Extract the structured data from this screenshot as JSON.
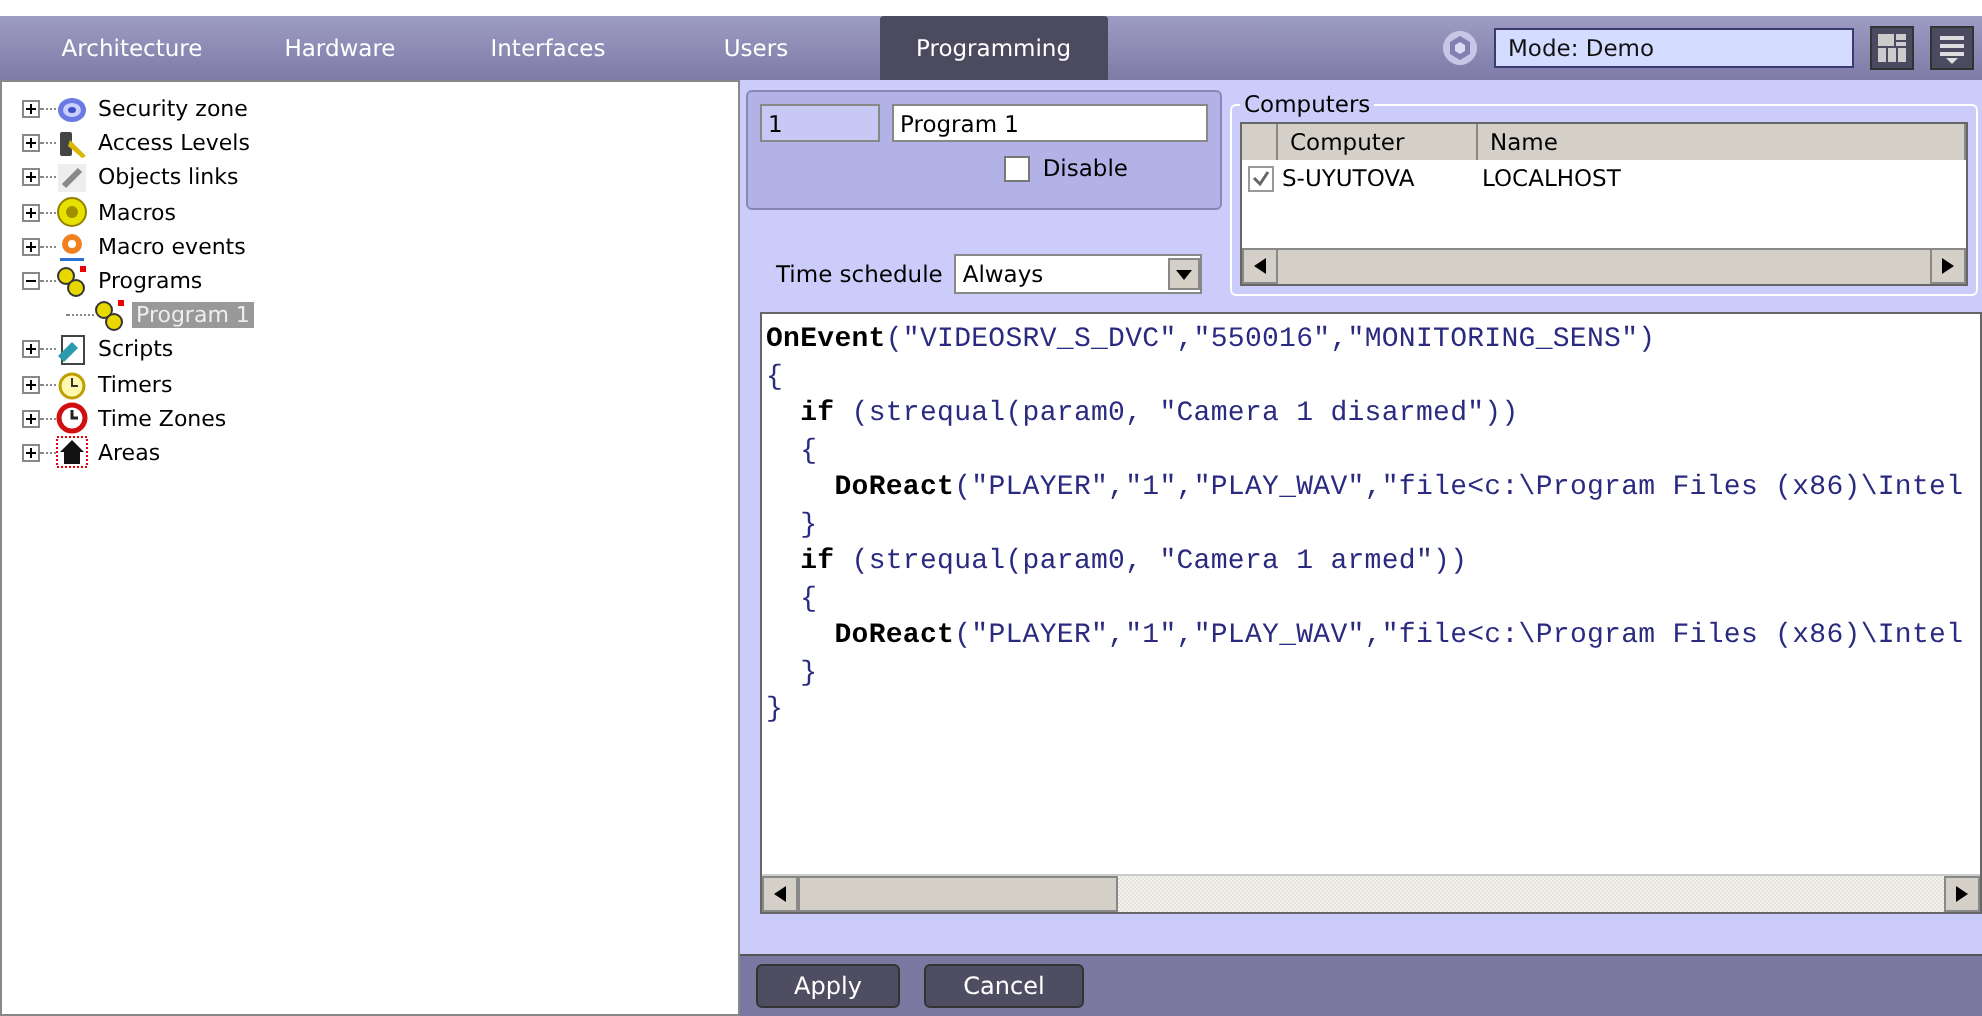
{
  "tabs": [
    {
      "label": "Architecture",
      "selected": false
    },
    {
      "label": "Hardware",
      "selected": false
    },
    {
      "label": "Interfaces",
      "selected": false
    },
    {
      "label": "Users",
      "selected": false
    },
    {
      "label": "Programming",
      "selected": true
    }
  ],
  "mode": {
    "value": "Mode: Demo"
  },
  "tree": [
    {
      "label": "Security zone",
      "kind": "zone",
      "expanded": false,
      "selected": false
    },
    {
      "label": "Access Levels",
      "kind": "key",
      "expanded": false,
      "selected": false
    },
    {
      "label": "Objects links",
      "kind": "link",
      "expanded": false,
      "selected": false
    },
    {
      "label": "Macros",
      "kind": "macro",
      "expanded": false,
      "selected": false
    },
    {
      "label": "Macro events",
      "kind": "event",
      "expanded": false,
      "selected": false
    },
    {
      "label": "Programs",
      "kind": "program",
      "expanded": true,
      "selected": false,
      "children": [
        {
          "label": "Program 1",
          "kind": "program",
          "selected": true
        }
      ]
    },
    {
      "label": "Scripts",
      "kind": "script",
      "expanded": false,
      "selected": false
    },
    {
      "label": "Timers",
      "kind": "timer",
      "expanded": false,
      "selected": false
    },
    {
      "label": "Time Zones",
      "kind": "clock",
      "expanded": false,
      "selected": false
    },
    {
      "label": "Areas",
      "kind": "house",
      "expanded": false,
      "selected": false
    }
  ],
  "program": {
    "id": "1",
    "name": "Program 1",
    "disable": {
      "label": "Disable",
      "checked": false
    }
  },
  "time_schedule": {
    "label": "Time schedule",
    "value": "Always"
  },
  "computers": {
    "title": "Computers",
    "columns": [
      "Computer",
      "Name"
    ],
    "rows": [
      {
        "checked": true,
        "computer": "S-UYUTOVA",
        "name": "LOCALHOST"
      }
    ]
  },
  "code": [
    "**OnEvent**(\"VIDEOSRV_S_DVC\",\"550016\",\"MONITORING_SENS\")",
    "{",
    "  **if** (strequal(param0, \"Camera 1 disarmed\"))",
    "  {",
    "    **DoReact**(\"PLAYER\",\"1\",\"PLAY_WAV\",\"file<c:\\Program Files (x86)\\Intel",
    "  }",
    "  **if** (strequal(param0, \"Camera 1 armed\"))",
    "  {",
    "    **DoReact**(\"PLAYER\",\"1\",\"PLAY_WAV\",\"file<c:\\Program Files (x86)\\Intel",
    "  }",
    "}"
  ],
  "buttons": [
    "Apply",
    "Cancel"
  ]
}
